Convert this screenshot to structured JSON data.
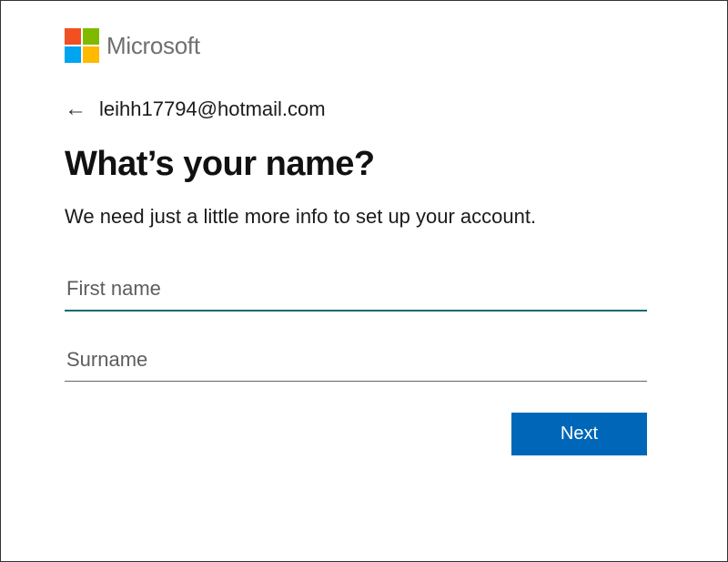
{
  "header": {
    "brand": "Microsoft"
  },
  "identity": {
    "email": "leihh17794@hotmail.com"
  },
  "form": {
    "title": "What’s your name?",
    "subtitle": "We need just a little more info to set up your account.",
    "first_name_placeholder": "First name",
    "first_name_value": "",
    "surname_placeholder": "Surname",
    "surname_value": "",
    "next_label": "Next"
  },
  "icons": {
    "back": "←"
  }
}
